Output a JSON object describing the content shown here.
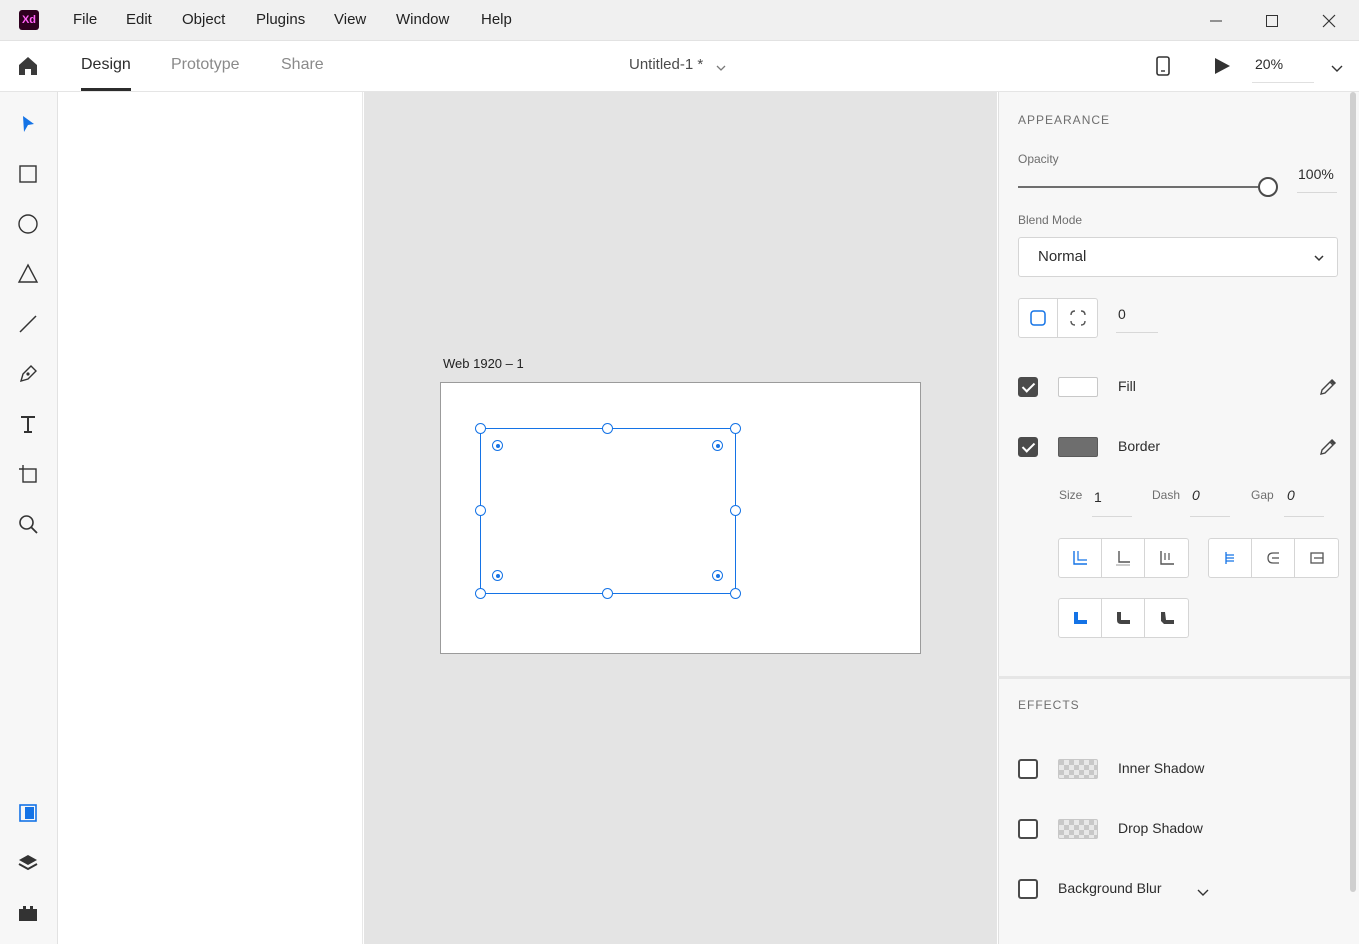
{
  "app": {
    "logo_text": "Xd"
  },
  "menu": [
    "File",
    "Edit",
    "Object",
    "Plugins",
    "View",
    "Window",
    "Help"
  ],
  "tabs": [
    "Design",
    "Prototype",
    "Share"
  ],
  "document": {
    "title": "Untitled-1 *"
  },
  "zoom": {
    "value": "20%"
  },
  "artboard": {
    "label": "Web 1920 – 1"
  },
  "appearance": {
    "section_title": "APPEARANCE",
    "opacity_label": "Opacity",
    "opacity_value": "100%",
    "opacity_level": 1.0,
    "blend_label": "Blend Mode",
    "blend_value": "Normal",
    "corner_radius": "0",
    "fill_label": "Fill",
    "fill_color": "#ffffff",
    "fill_checked": true,
    "border_label": "Border",
    "border_color": "#6e6e6e",
    "border_checked": true,
    "size_label": "Size",
    "size_value": "1",
    "dash_label": "Dash",
    "dash_value": "0",
    "gap_label": "Gap",
    "gap_value": "0"
  },
  "effects": {
    "section_title": "EFFECTS",
    "inner_shadow": "Inner Shadow",
    "drop_shadow": "Drop Shadow",
    "background_blur": "Background Blur"
  },
  "colors": {
    "accent": "#1473e6",
    "selection": "#1473e6",
    "xd_logo_bg": "#2e001f",
    "xd_logo_fg": "#ff61f6"
  }
}
